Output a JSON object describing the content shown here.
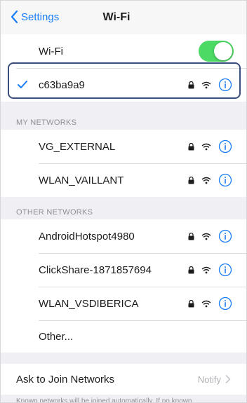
{
  "navbar": {
    "back_label": "Settings",
    "title": "Wi-Fi"
  },
  "wifi_toggle": {
    "label": "Wi-Fi",
    "state": "on",
    "color": "#4cd964"
  },
  "connected": {
    "name": "c63ba9a9",
    "icons": [
      "lock-icon",
      "wifi-icon",
      "info-icon"
    ]
  },
  "sections": {
    "my_networks": {
      "header": "MY NETWORKS",
      "items": [
        {
          "name": "VG_EXTERNAL"
        },
        {
          "name": "WLAN_VAILLANT"
        }
      ]
    },
    "other_networks": {
      "header": "OTHER NETWORKS",
      "items": [
        {
          "name": "AndroidHotspot4980"
        },
        {
          "name": "ClickShare-1871857694"
        },
        {
          "name": "WLAN_VSDIBERICA"
        }
      ],
      "other_label": "Other..."
    }
  },
  "ask_join": {
    "label": "Ask to Join Networks",
    "value": "Notify"
  },
  "footer_text": "Known networks will be joined automatically. If no known",
  "accent_color": "#1a7cf5",
  "highlight_color": "#3b4d7a"
}
